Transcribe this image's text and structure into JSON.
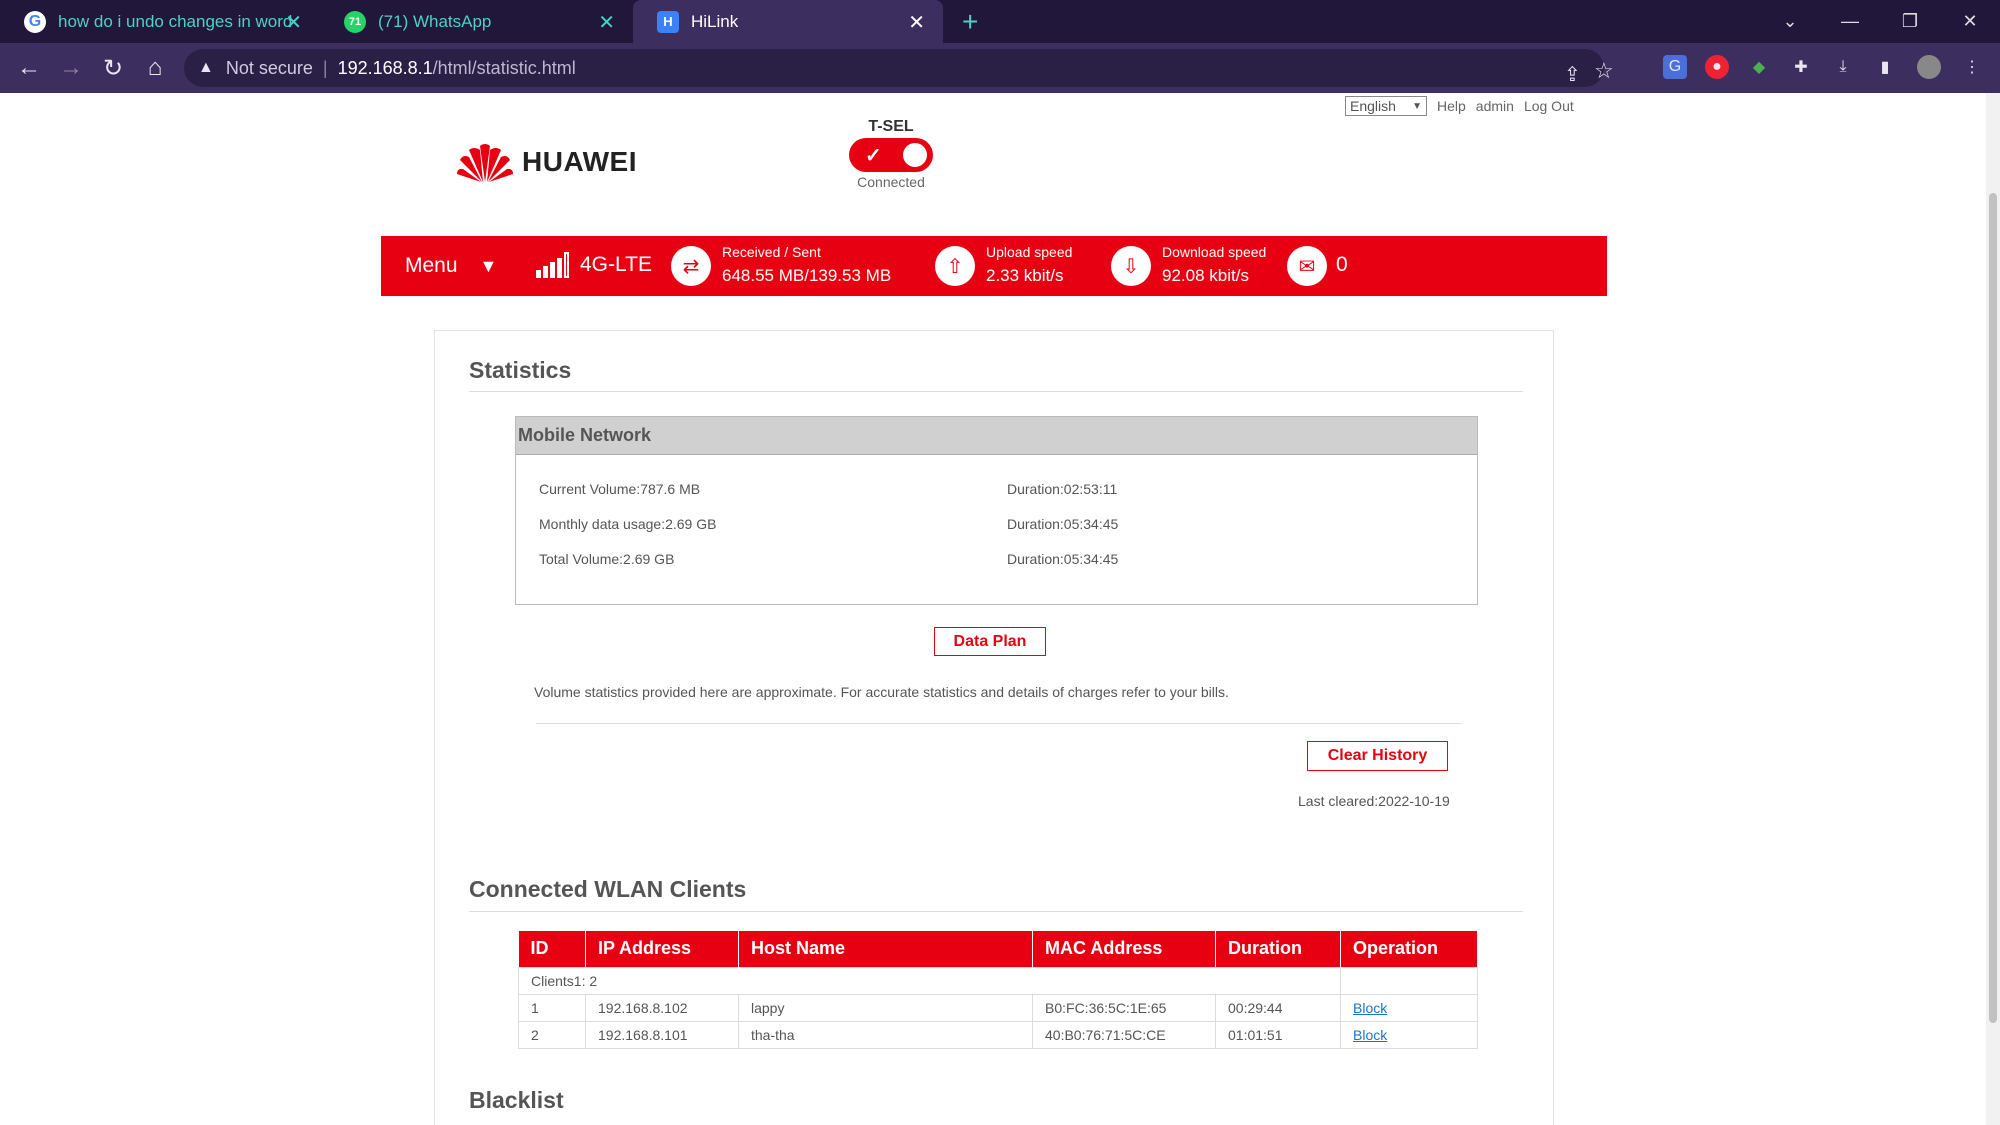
{
  "browser": {
    "tabs": [
      {
        "title": "how do i undo changes in word a",
        "favicon": "G"
      },
      {
        "title": "(71) WhatsApp",
        "favicon": "71"
      },
      {
        "title": "HiLink",
        "favicon": "H"
      }
    ],
    "address": {
      "security": "Not secure",
      "host": "192.168.8.1",
      "path": "/html/statistic.html"
    }
  },
  "header": {
    "language": "English",
    "links": {
      "help": "Help",
      "admin": "admin",
      "logout": "Log Out"
    },
    "logo_text": "HUAWEI",
    "operator": "T-SEL",
    "connection_status": "Connected"
  },
  "statusbar": {
    "menu_label": "Menu",
    "network_type": "4G-LTE",
    "received_sent_label": "Received / Sent",
    "received_sent_value": "648.55 MB/139.53 MB",
    "upload_label": "Upload speed",
    "upload_value": "2.33 kbit/s",
    "download_label": "Download speed",
    "download_value": "92.08 kbit/s",
    "messages_count": "0"
  },
  "statistics": {
    "title": "Statistics",
    "mobile_network_title": "Mobile Network",
    "rows": [
      {
        "volume": "Current Volume:787.6 MB",
        "duration": "Duration:02:53:11"
      },
      {
        "volume": "Monthly data usage:2.69 GB",
        "duration": "Duration:05:34:45"
      },
      {
        "volume": "Total Volume:2.69 GB",
        "duration": "Duration:05:34:45"
      }
    ],
    "data_plan_label": "Data Plan",
    "note": "Volume statistics provided here are approximate. For accurate statistics and details of charges refer to your bills.",
    "clear_history_label": "Clear History",
    "last_cleared": "Last cleared:2022-10-19"
  },
  "wlan": {
    "title": "Connected WLAN Clients",
    "columns": [
      "ID",
      "IP Address",
      "Host Name",
      "MAC Address",
      "Duration",
      "Operation"
    ],
    "group_label": "Clients1: 2",
    "clients": [
      {
        "id": "1",
        "ip": "192.168.8.102",
        "host": "lappy",
        "mac": "B0:FC:36:5C:1E:65",
        "duration": "00:29:44",
        "op": "Block"
      },
      {
        "id": "2",
        "ip": "192.168.8.101",
        "host": "tha-tha",
        "mac": "40:B0:76:71:5C:CE",
        "duration": "01:01:51",
        "op": "Block"
      }
    ]
  },
  "blacklist": {
    "title": "Blacklist"
  },
  "colors": {
    "brand_red": "#e60012",
    "tabbar": "#20173a",
    "toolbar": "#3c2f60"
  }
}
